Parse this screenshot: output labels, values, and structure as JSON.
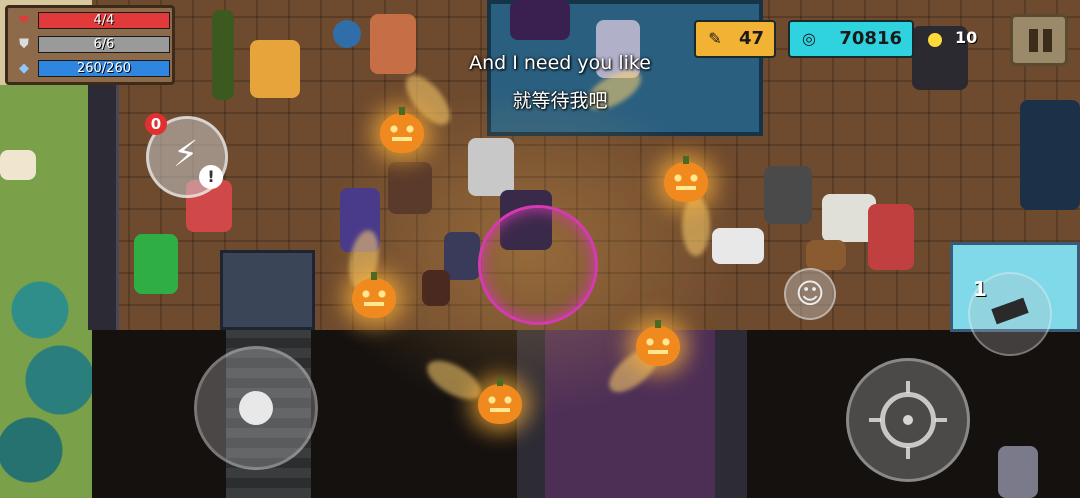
{
  "hud": {
    "health": {
      "icon": "heart-icon",
      "glyph": "❤",
      "text": "4/4",
      "fraction": 1.0,
      "color": "#e23a3a"
    },
    "armor": {
      "icon": "shield-icon",
      "glyph": "⛊",
      "text": "6/6",
      "fraction": 1.0,
      "color": "#9a9a9a"
    },
    "energy": {
      "icon": "diamond-icon",
      "glyph": "◆",
      "text": "260/260",
      "fraction": 1.0,
      "color": "#2f86e0"
    }
  },
  "currency": {
    "materials": {
      "icon": "feather-icon",
      "glyph": "✎",
      "value": "47",
      "color": "#f2b233"
    },
    "gems": {
      "icon": "gem-icon",
      "glyph": "◎",
      "value": "70816",
      "color": "#2fd3e0"
    }
  },
  "ammo": {
    "value": "10"
  },
  "subtitle": {
    "line1": "And I need you like",
    "line2": "就等待我吧"
  },
  "skill": {
    "icon": "lightning-icon",
    "glyph": "⚡",
    "count": "0",
    "warning": "!"
  },
  "emote": {
    "icon": "smiley-icon",
    "glyph": "☺"
  },
  "weapon": {
    "slot": "1",
    "icon": "gun-icon"
  },
  "controls": {
    "pause_icon": "pause-icon",
    "move_icon": "joystick-icon",
    "attack_icon": "crosshair-icon"
  }
}
